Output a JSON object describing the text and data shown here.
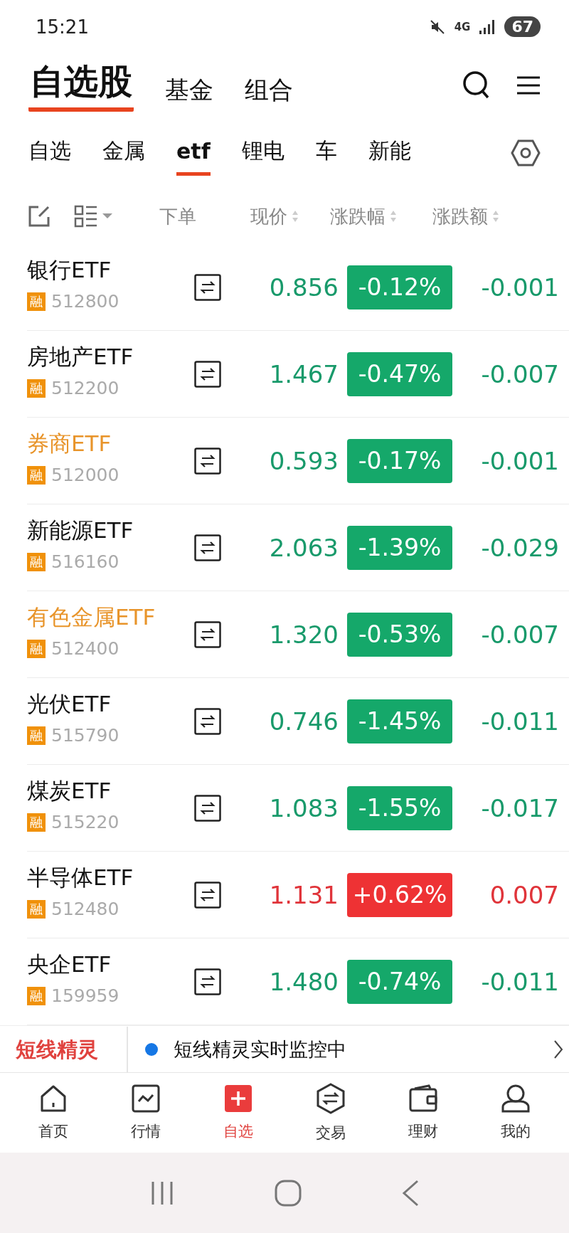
{
  "status_bar": {
    "time": "15:21",
    "battery": "67",
    "network": "4G"
  },
  "header": {
    "tabs": [
      {
        "label": "自选股",
        "selected": true
      },
      {
        "label": "基金",
        "selected": false
      },
      {
        "label": "组合",
        "selected": false
      }
    ]
  },
  "categories": [
    {
      "label": "自选",
      "selected": false
    },
    {
      "label": "金属",
      "selected": false
    },
    {
      "label": "etf",
      "selected": true
    },
    {
      "label": "锂电",
      "selected": false
    },
    {
      "label": "车",
      "selected": false
    },
    {
      "label": "新能",
      "selected": false
    }
  ],
  "columns": {
    "order": "下单",
    "price": "现价",
    "change_pct": "涨跌幅",
    "change": "涨跌额"
  },
  "rows": [
    {
      "name": "银行ETF",
      "highlighted": false,
      "tag": "融",
      "code": "512800",
      "price": "0.856",
      "change_pct": "-0.12%",
      "change": "-0.001",
      "rising": false
    },
    {
      "name": "房地产ETF",
      "highlighted": false,
      "tag": "融",
      "code": "512200",
      "price": "1.467",
      "change_pct": "-0.47%",
      "change": "-0.007",
      "rising": false
    },
    {
      "name": "券商ETF",
      "highlighted": true,
      "tag": "融",
      "code": "512000",
      "price": "0.593",
      "change_pct": "-0.17%",
      "change": "-0.001",
      "rising": false
    },
    {
      "name": "新能源ETF",
      "highlighted": false,
      "tag": "融",
      "code": "516160",
      "price": "2.063",
      "change_pct": "-1.39%",
      "change": "-0.029",
      "rising": false
    },
    {
      "name": "有色金属ETF",
      "highlighted": true,
      "tag": "融",
      "code": "512400",
      "price": "1.320",
      "change_pct": "-0.53%",
      "change": "-0.007",
      "rising": false
    },
    {
      "name": "光伏ETF",
      "highlighted": false,
      "tag": "融",
      "code": "515790",
      "price": "0.746",
      "change_pct": "-1.45%",
      "change": "-0.011",
      "rising": false
    },
    {
      "name": "煤炭ETF",
      "highlighted": false,
      "tag": "融",
      "code": "515220",
      "price": "1.083",
      "change_pct": "-1.55%",
      "change": "-0.017",
      "rising": false
    },
    {
      "name": "半导体ETF",
      "highlighted": false,
      "tag": "融",
      "code": "512480",
      "price": "1.131",
      "change_pct": "+0.62%",
      "change": "0.007",
      "rising": true
    },
    {
      "name": "央企ETF",
      "highlighted": false,
      "tag": "融",
      "code": "159959",
      "price": "1.480",
      "change_pct": "-0.74%",
      "change": "-0.011",
      "rising": false
    }
  ],
  "banner": {
    "title": "短线精灵",
    "message": "短线精灵实时监控中"
  },
  "tab_bar": [
    {
      "label": "首页",
      "kind": "home",
      "selected": false
    },
    {
      "label": "行情",
      "kind": "chart",
      "selected": false
    },
    {
      "label": "自选",
      "kind": "plus",
      "selected": true
    },
    {
      "label": "交易",
      "kind": "trade",
      "selected": false
    },
    {
      "label": "理财",
      "kind": "wallet",
      "selected": false
    },
    {
      "label": "我的",
      "kind": "user",
      "selected": false
    }
  ]
}
